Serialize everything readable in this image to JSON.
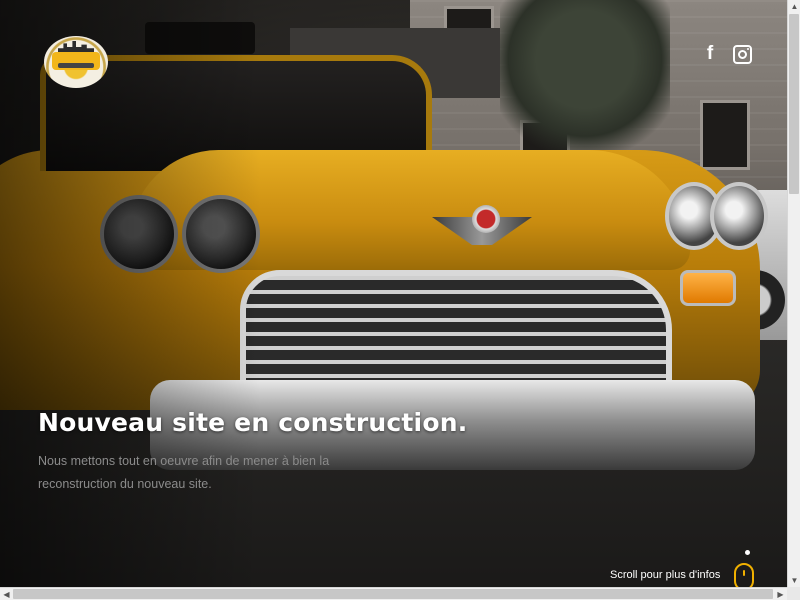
{
  "header": {
    "logo_name": "new-york-taxi-logo",
    "social": [
      {
        "name": "facebook-icon",
        "glyph": "f"
      },
      {
        "name": "instagram-icon"
      }
    ]
  },
  "hero": {
    "title": "Nouveau site en construction.",
    "subtitle": "Nous mettons tout en oeuvre afin de mener à bien la reconstruction du nouveau site."
  },
  "scroll_hint": {
    "label": "Scroll pour plus d'infos"
  },
  "colors": {
    "accent": "#f0b000",
    "title": "#ffffff",
    "subtitle": "#8b8b8b"
  }
}
